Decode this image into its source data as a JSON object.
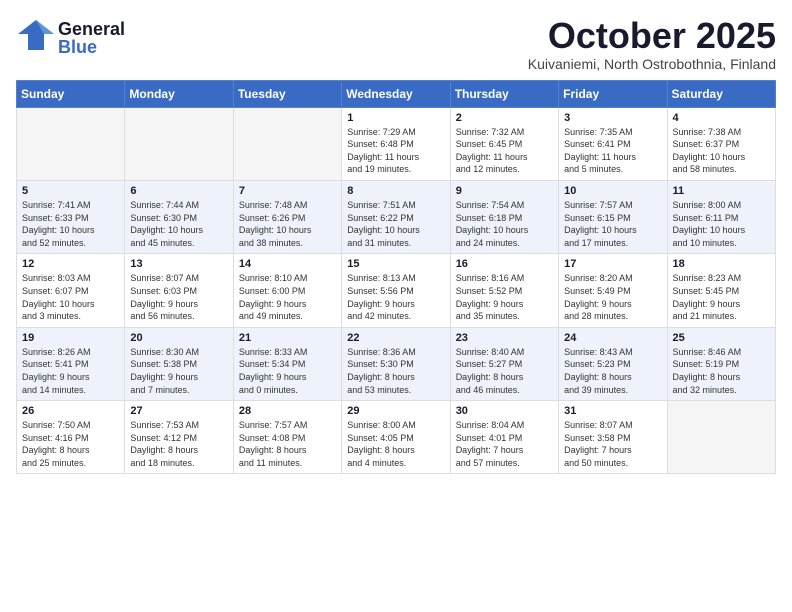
{
  "header": {
    "logo_general": "General",
    "logo_blue": "Blue",
    "month": "October 2025",
    "location": "Kuivaniemi, North Ostrobothnia, Finland"
  },
  "weekdays": [
    "Sunday",
    "Monday",
    "Tuesday",
    "Wednesday",
    "Thursday",
    "Friday",
    "Saturday"
  ],
  "weeks": [
    [
      {
        "day": "",
        "info": ""
      },
      {
        "day": "",
        "info": ""
      },
      {
        "day": "",
        "info": ""
      },
      {
        "day": "1",
        "info": "Sunrise: 7:29 AM\nSunset: 6:48 PM\nDaylight: 11 hours\nand 19 minutes."
      },
      {
        "day": "2",
        "info": "Sunrise: 7:32 AM\nSunset: 6:45 PM\nDaylight: 11 hours\nand 12 minutes."
      },
      {
        "day": "3",
        "info": "Sunrise: 7:35 AM\nSunset: 6:41 PM\nDaylight: 11 hours\nand 5 minutes."
      },
      {
        "day": "4",
        "info": "Sunrise: 7:38 AM\nSunset: 6:37 PM\nDaylight: 10 hours\nand 58 minutes."
      }
    ],
    [
      {
        "day": "5",
        "info": "Sunrise: 7:41 AM\nSunset: 6:33 PM\nDaylight: 10 hours\nand 52 minutes."
      },
      {
        "day": "6",
        "info": "Sunrise: 7:44 AM\nSunset: 6:30 PM\nDaylight: 10 hours\nand 45 minutes."
      },
      {
        "day": "7",
        "info": "Sunrise: 7:48 AM\nSunset: 6:26 PM\nDaylight: 10 hours\nand 38 minutes."
      },
      {
        "day": "8",
        "info": "Sunrise: 7:51 AM\nSunset: 6:22 PM\nDaylight: 10 hours\nand 31 minutes."
      },
      {
        "day": "9",
        "info": "Sunrise: 7:54 AM\nSunset: 6:18 PM\nDaylight: 10 hours\nand 24 minutes."
      },
      {
        "day": "10",
        "info": "Sunrise: 7:57 AM\nSunset: 6:15 PM\nDaylight: 10 hours\nand 17 minutes."
      },
      {
        "day": "11",
        "info": "Sunrise: 8:00 AM\nSunset: 6:11 PM\nDaylight: 10 hours\nand 10 minutes."
      }
    ],
    [
      {
        "day": "12",
        "info": "Sunrise: 8:03 AM\nSunset: 6:07 PM\nDaylight: 10 hours\nand 3 minutes."
      },
      {
        "day": "13",
        "info": "Sunrise: 8:07 AM\nSunset: 6:03 PM\nDaylight: 9 hours\nand 56 minutes."
      },
      {
        "day": "14",
        "info": "Sunrise: 8:10 AM\nSunset: 6:00 PM\nDaylight: 9 hours\nand 49 minutes."
      },
      {
        "day": "15",
        "info": "Sunrise: 8:13 AM\nSunset: 5:56 PM\nDaylight: 9 hours\nand 42 minutes."
      },
      {
        "day": "16",
        "info": "Sunrise: 8:16 AM\nSunset: 5:52 PM\nDaylight: 9 hours\nand 35 minutes."
      },
      {
        "day": "17",
        "info": "Sunrise: 8:20 AM\nSunset: 5:49 PM\nDaylight: 9 hours\nand 28 minutes."
      },
      {
        "day": "18",
        "info": "Sunrise: 8:23 AM\nSunset: 5:45 PM\nDaylight: 9 hours\nand 21 minutes."
      }
    ],
    [
      {
        "day": "19",
        "info": "Sunrise: 8:26 AM\nSunset: 5:41 PM\nDaylight: 9 hours\nand 14 minutes."
      },
      {
        "day": "20",
        "info": "Sunrise: 8:30 AM\nSunset: 5:38 PM\nDaylight: 9 hours\nand 7 minutes."
      },
      {
        "day": "21",
        "info": "Sunrise: 8:33 AM\nSunset: 5:34 PM\nDaylight: 9 hours\nand 0 minutes."
      },
      {
        "day": "22",
        "info": "Sunrise: 8:36 AM\nSunset: 5:30 PM\nDaylight: 8 hours\nand 53 minutes."
      },
      {
        "day": "23",
        "info": "Sunrise: 8:40 AM\nSunset: 5:27 PM\nDaylight: 8 hours\nand 46 minutes."
      },
      {
        "day": "24",
        "info": "Sunrise: 8:43 AM\nSunset: 5:23 PM\nDaylight: 8 hours\nand 39 minutes."
      },
      {
        "day": "25",
        "info": "Sunrise: 8:46 AM\nSunset: 5:19 PM\nDaylight: 8 hours\nand 32 minutes."
      }
    ],
    [
      {
        "day": "26",
        "info": "Sunrise: 7:50 AM\nSunset: 4:16 PM\nDaylight: 8 hours\nand 25 minutes."
      },
      {
        "day": "27",
        "info": "Sunrise: 7:53 AM\nSunset: 4:12 PM\nDaylight: 8 hours\nand 18 minutes."
      },
      {
        "day": "28",
        "info": "Sunrise: 7:57 AM\nSunset: 4:08 PM\nDaylight: 8 hours\nand 11 minutes."
      },
      {
        "day": "29",
        "info": "Sunrise: 8:00 AM\nSunset: 4:05 PM\nDaylight: 8 hours\nand 4 minutes."
      },
      {
        "day": "30",
        "info": "Sunrise: 8:04 AM\nSunset: 4:01 PM\nDaylight: 7 hours\nand 57 minutes."
      },
      {
        "day": "31",
        "info": "Sunrise: 8:07 AM\nSunset: 3:58 PM\nDaylight: 7 hours\nand 50 minutes."
      },
      {
        "day": "",
        "info": ""
      }
    ]
  ]
}
